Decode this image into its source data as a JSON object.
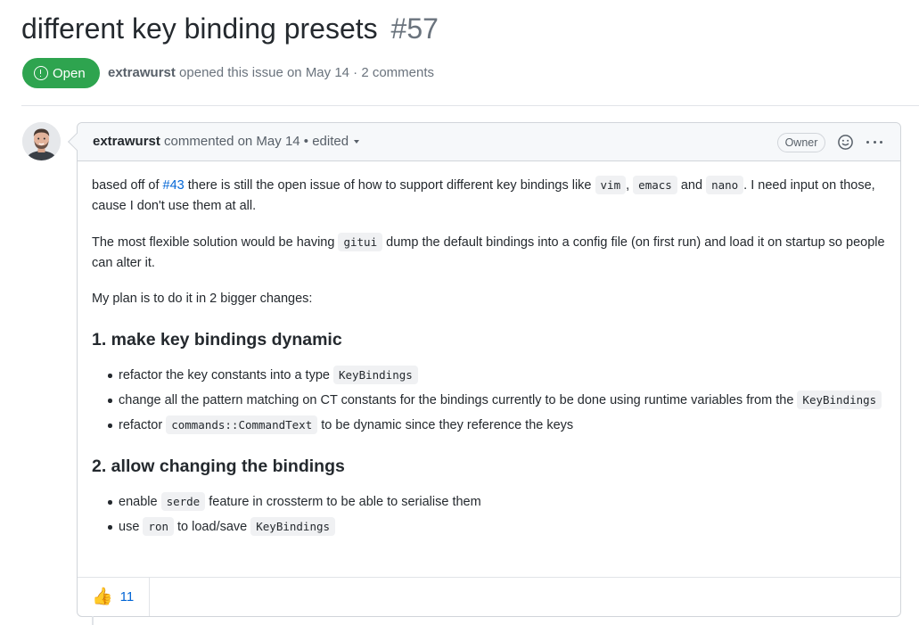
{
  "issue": {
    "title": "different key binding presets",
    "number": "#57",
    "state": "Open",
    "author": "extrawurst",
    "opened_text": "opened this issue on May 14 · 2 comments"
  },
  "comment": {
    "author": "extrawurst",
    "meta": "commented on May 14 • edited",
    "role_badge": "Owner",
    "p1": {
      "t1": "based off of ",
      "link": "#43",
      "t2": " there is still the open issue of how to support different key bindings like ",
      "c1": "vim",
      "t3": ", ",
      "c2": "emacs",
      "t4": " and ",
      "c3": "nano",
      "t5": ". I need input on those, cause I don't use them at all."
    },
    "p2": {
      "t1": "The most flexible solution would be having ",
      "c1": "gitui",
      "t2": " dump the default bindings into a config file (on first run) and load it on startup so people can alter it."
    },
    "p3": "My plan is to do it in 2 bigger changes:",
    "h1": "1. make key bindings dynamic",
    "list1": [
      {
        "t1": "refactor the key constants into a type ",
        "c1": "KeyBindings"
      },
      {
        "t1": "change all the pattern matching on CT constants for the bindings currently to be done using runtime variables from the ",
        "c1": "KeyBindings"
      },
      {
        "t1": "refactor ",
        "c1": "commands::CommandText",
        "t2": " to be dynamic since they reference the keys"
      }
    ],
    "h2": "2. allow changing the bindings",
    "list2": [
      {
        "t1": "enable ",
        "c1": "serde",
        "t2": " feature in crossterm to be able to serialise them"
      },
      {
        "t1": "use ",
        "c1": "ron",
        "t2": " to load/save ",
        "c2": "KeyBindings"
      }
    ],
    "reaction": {
      "icon": "thumbs-up-icon",
      "emoji": "👍",
      "count": "11"
    }
  },
  "colors": {
    "open_green": "#2ea44f",
    "link_blue": "#0366d6",
    "muted": "#586069"
  }
}
